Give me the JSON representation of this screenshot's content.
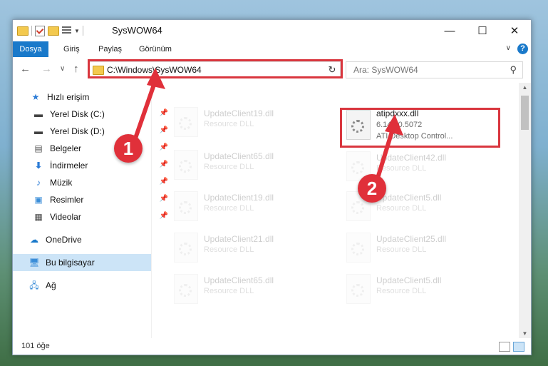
{
  "window": {
    "title": "SysWOW64",
    "minimize": "—",
    "maximize": "☐",
    "close": "✕"
  },
  "ribbon": {
    "tabs": [
      "Dosya",
      "Giriş",
      "Paylaş",
      "Görünüm"
    ],
    "caret": "∨",
    "help": "?"
  },
  "nav": {
    "back": "←",
    "forward": "→",
    "recent": "∨",
    "up": "↑",
    "address": "C:\\Windows\\SysWOW64",
    "address_chevron": "∨",
    "refresh": "↻",
    "search_placeholder": "Ara: SysWOW64"
  },
  "sidebar": {
    "items": [
      {
        "label": "Hızlı erişim",
        "icon": "star-icon"
      },
      {
        "label": "Yerel Disk (C:)",
        "icon": "drive-icon"
      },
      {
        "label": "Yerel Disk (D:)",
        "icon": "drive-icon"
      },
      {
        "label": "Belgeler",
        "icon": "documents-icon"
      },
      {
        "label": "İndirmeler",
        "icon": "download-icon"
      },
      {
        "label": "Müzik",
        "icon": "music-icon"
      },
      {
        "label": "Resimler",
        "icon": "pictures-icon"
      },
      {
        "label": "Videolar",
        "icon": "videos-icon"
      },
      {
        "label": "OneDrive",
        "icon": "cloud-icon"
      },
      {
        "label": "Bu bilgisayar",
        "icon": "computer-icon"
      },
      {
        "label": "Ağ",
        "icon": "network-icon"
      }
    ]
  },
  "files": {
    "left": [
      {
        "name": "UpdateClient19.dll",
        "desc": "Resource DLL"
      },
      {
        "name": "UpdateClient65.dll",
        "desc": "Resource DLL"
      },
      {
        "name": "UpdateClient19.dll",
        "desc": "Resource DLL"
      },
      {
        "name": "UpdateClient21.dll",
        "desc": "Resource DLL"
      },
      {
        "name": "UpdateClient65.dll",
        "desc": "Resource DLL"
      }
    ],
    "right": [
      {
        "name": "UpdateClient42.dll",
        "desc": "Resource DLL"
      },
      {
        "name": "UpdateClient5.dll",
        "desc": "Resource DLL"
      },
      {
        "name": "UpdateClient25.dll",
        "desc": "Resource DLL"
      },
      {
        "name": "UpdateClient5.dll",
        "desc": "Resource DLL"
      }
    ],
    "highlighted": {
      "name": "atipdxxx.dll",
      "version": "6.14.10.5072",
      "desc": "ATI Desktop Control..."
    }
  },
  "status": {
    "count": "101 öğe"
  },
  "callouts": [
    "1",
    "2"
  ],
  "colors": {
    "accent": "#1979ca",
    "highlight": "#d9363e"
  }
}
